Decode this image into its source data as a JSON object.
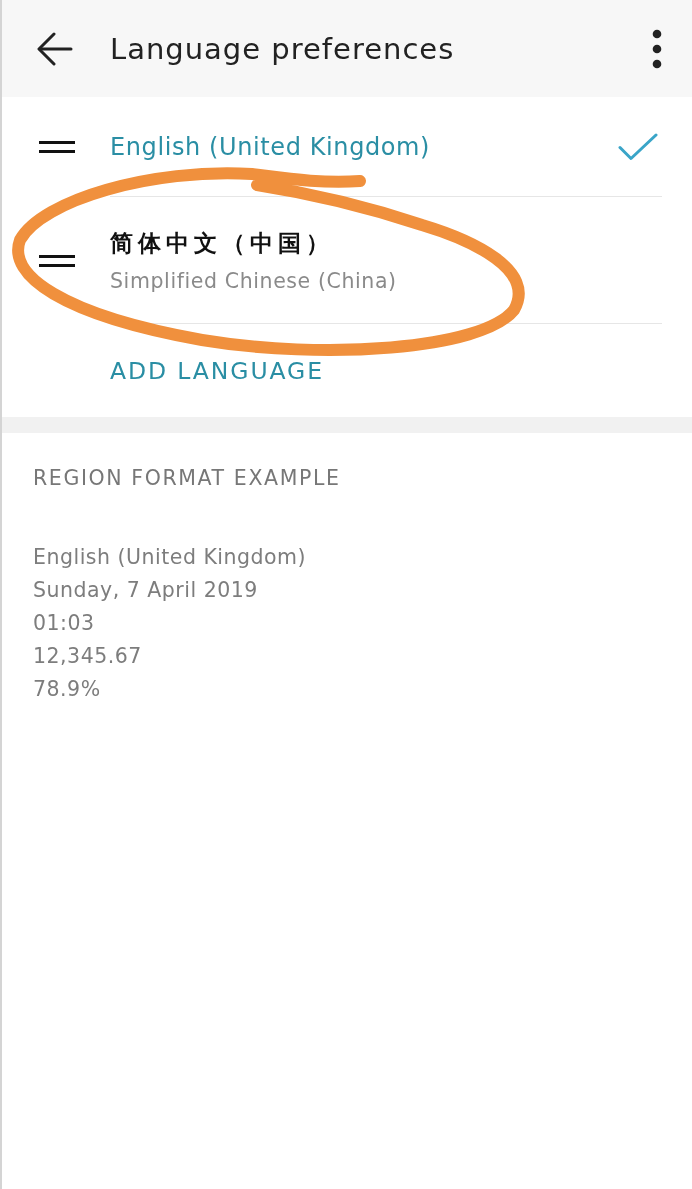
{
  "app_bar": {
    "title": "Language preferences"
  },
  "languages": [
    {
      "name": "English (United Kingdom)",
      "selected": true,
      "circled": false
    },
    {
      "name": "简体中文（中国）",
      "subtitle": "Simplified Chinese (China)",
      "selected": false,
      "circled": true
    }
  ],
  "add_language": "ADD LANGUAGE",
  "region_format": {
    "heading": "REGION FORMAT EXAMPLE",
    "examples": [
      "English (United Kingdom)",
      "Sunday, 7 April 2019",
      "01:03",
      "12,345.67",
      "78.9%"
    ]
  }
}
